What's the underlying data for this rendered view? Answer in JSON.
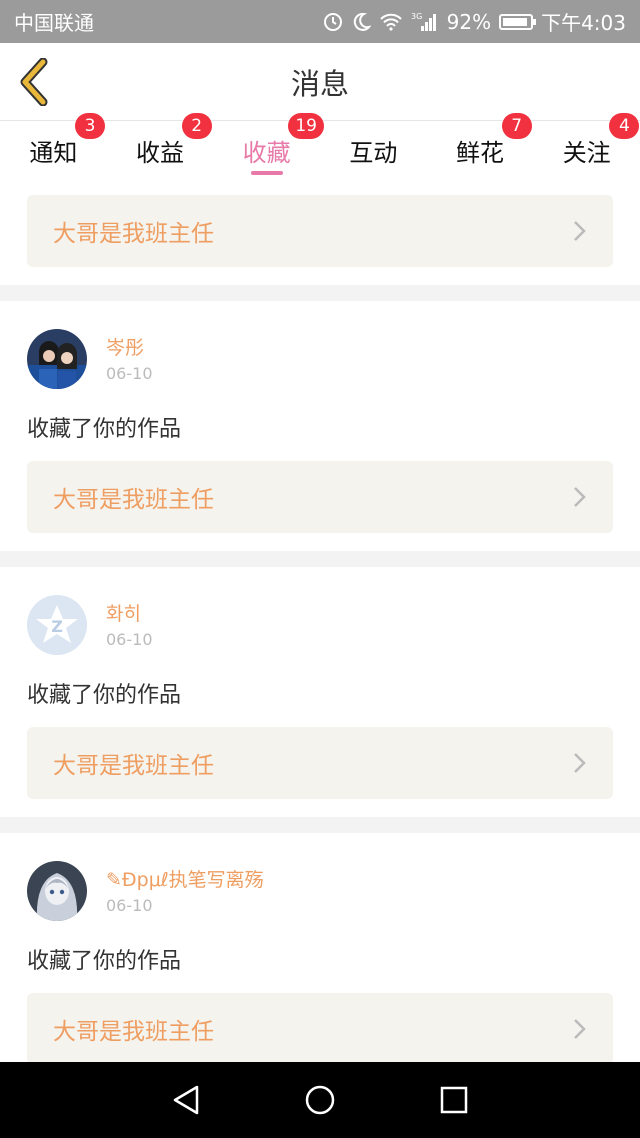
{
  "status_bar": {
    "carrier": "中国联通",
    "network": "3G",
    "battery": "92%",
    "time": "下午4:03",
    "icons": [
      "alarm-icon",
      "moon-icon",
      "wifi-icon",
      "signal-icon",
      "battery-icon"
    ]
  },
  "header": {
    "title": "消息",
    "back_icon": "chevron-left-icon",
    "accent": "#e9b73a"
  },
  "tabs": [
    {
      "label": "通知",
      "badge": "3"
    },
    {
      "label": "收益",
      "badge": "2"
    },
    {
      "label": "收藏",
      "badge": "19",
      "active": true
    },
    {
      "label": "互动",
      "badge": ""
    },
    {
      "label": "鲜花",
      "badge": "7"
    },
    {
      "label": "关注",
      "badge": "4"
    }
  ],
  "top_card": {
    "title": "大哥是我班主任"
  },
  "items": [
    {
      "user": "岑彤",
      "date": "06-10",
      "action": "收藏了你的作品",
      "work_title": "大哥是我班主任"
    },
    {
      "user": "화히",
      "date": "06-10",
      "action": "收藏了你的作品",
      "work_title": "大哥是我班主任"
    },
    {
      "user": "✎Ðpμℓ执笔写离殇",
      "date": "06-10",
      "action": "收藏了你的作品",
      "work_title": "大哥是我班主任"
    }
  ],
  "colors": {
    "accent_pink": "#e77aa8",
    "badge_red": "#f1313f",
    "work_title_orange": "#ef9e62",
    "card_bg": "#f4f3ee"
  },
  "nav": [
    "back-triangle-icon",
    "home-circle-icon",
    "recent-square-icon"
  ]
}
